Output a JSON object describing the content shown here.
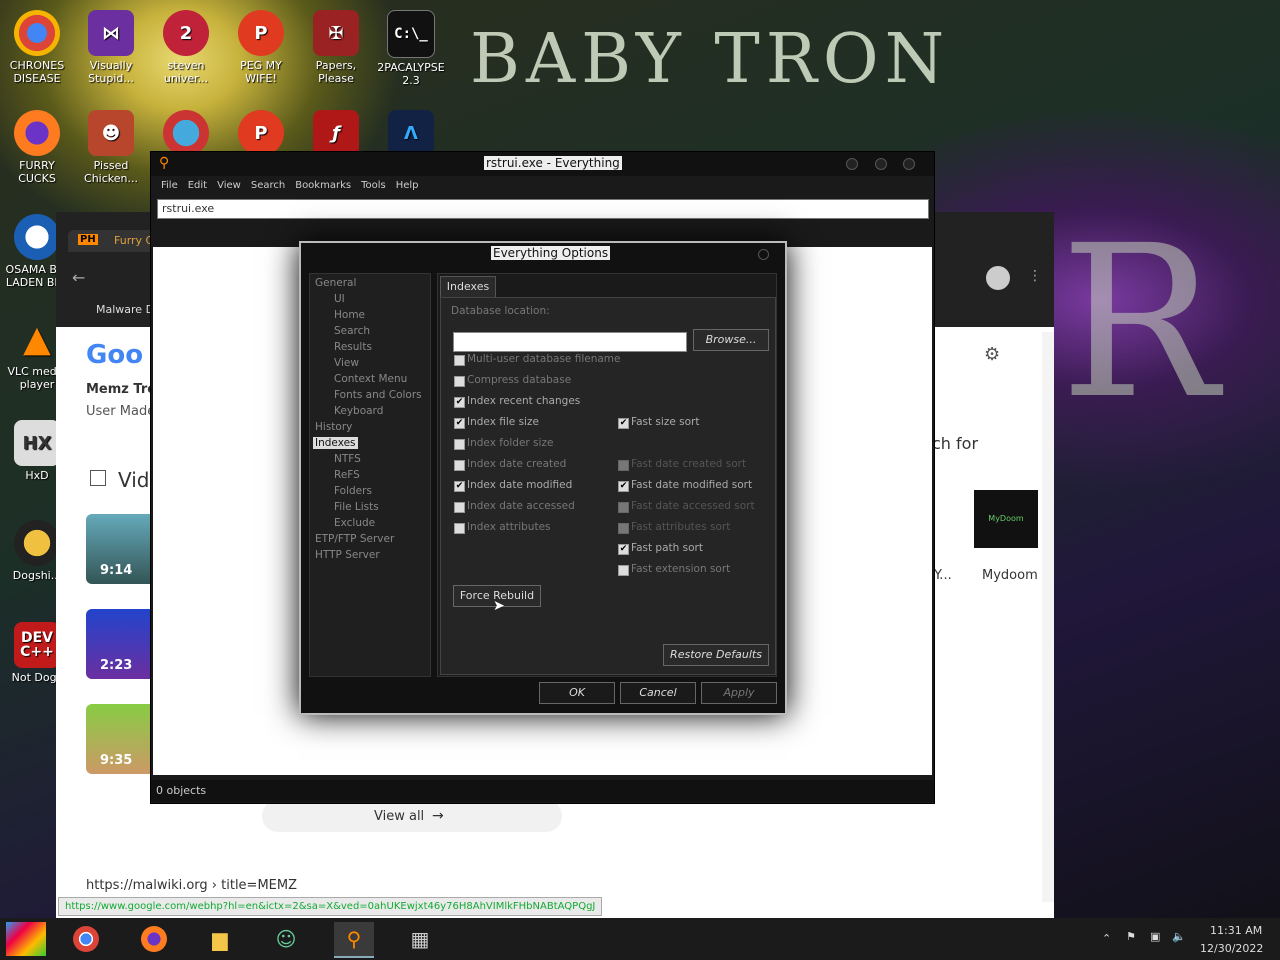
{
  "desktop": {
    "brand_text": "BABY TRON",
    "brand_text2": "R",
    "icons": [
      {
        "label": "CHRONES DISEASE",
        "icon": "chrome-icon"
      },
      {
        "label": "Visually Stupid...",
        "icon": "visual-studio-icon"
      },
      {
        "label": "steven univer...",
        "icon": "game-icon"
      },
      {
        "label": "PEG MY WIFE!",
        "icon": "game-icon"
      },
      {
        "label": "Papers, Please",
        "icon": "game-icon"
      },
      {
        "label": "2PACALYPSE 2.3",
        "icon": "terminal-icon"
      },
      {
        "label": "FURRY CUCKS",
        "icon": "firefox-icon"
      },
      {
        "label": "Pissed Chicken...",
        "icon": "game-icon"
      },
      {
        "label": "OSAMA BIN LADEN BI...",
        "icon": "obama-icon"
      },
      {
        "label": "VLC media player",
        "icon": "vlc-icon"
      },
      {
        "label": "HxD",
        "icon": "hxd-icon"
      },
      {
        "label": "Dogshi...",
        "icon": "app-icon"
      },
      {
        "label": "Not Dogs",
        "icon": "devcpp-icon"
      }
    ]
  },
  "chrome": {
    "tab_title": "Furry Ga...",
    "bookmark": "Malware D...",
    "result_title": "Memz Tro...",
    "result_sub": "User Made...",
    "videos_label": "Vid...",
    "durations": [
      "9:14",
      "2:23",
      "9:35"
    ],
    "search_for": "ch for",
    "mydoom_label": "Mydoom",
    "y_label": "Y...",
    "view_all": "View all",
    "url_line": "https://malwiki.org › title=MEMZ",
    "status_url": "https://www.google.com/webhp?hl=en&ictx=2&sa=X&ved=0ahUKEwjxt46y76H8AhVIMlkFHbNABtAQPQgJ"
  },
  "everything": {
    "title": "rstrui.exe - Everything",
    "menu": [
      "File",
      "Edit",
      "View",
      "Search",
      "Bookmarks",
      "Tools",
      "Help"
    ],
    "search_value": "rstrui.exe",
    "status": "0 objects"
  },
  "options": {
    "title": "Everything Options",
    "tree": [
      {
        "label": "General",
        "level": 0
      },
      {
        "label": "UI",
        "level": 1
      },
      {
        "label": "Home",
        "level": 1
      },
      {
        "label": "Search",
        "level": 1
      },
      {
        "label": "Results",
        "level": 1
      },
      {
        "label": "View",
        "level": 1
      },
      {
        "label": "Context Menu",
        "level": 1
      },
      {
        "label": "Fonts and Colors",
        "level": 1
      },
      {
        "label": "Keyboard",
        "level": 1
      },
      {
        "label": "History",
        "level": 0
      },
      {
        "label": "Indexes",
        "level": 0,
        "selected": true
      },
      {
        "label": "NTFS",
        "level": 1
      },
      {
        "label": "ReFS",
        "level": 1
      },
      {
        "label": "Folders",
        "level": 1
      },
      {
        "label": "File Lists",
        "level": 1
      },
      {
        "label": "Exclude",
        "level": 1
      },
      {
        "label": "ETP/FTP Server",
        "level": 0
      },
      {
        "label": "HTTP Server",
        "level": 0
      }
    ],
    "tab": "Indexes",
    "db_location_label": "Database location:",
    "db_location_value": "",
    "browse": "Browse...",
    "left_checks": [
      {
        "label": "Multi-user database filename",
        "checked": false
      },
      {
        "label": "Compress database",
        "checked": false
      },
      {
        "label": "Index recent changes",
        "checked": true
      },
      {
        "label": "Index file size",
        "checked": true
      },
      {
        "label": "Index folder size",
        "checked": false
      },
      {
        "label": "Index date created",
        "checked": false
      },
      {
        "label": "Index date modified",
        "checked": true
      },
      {
        "label": "Index date accessed",
        "checked": false
      },
      {
        "label": "Index attributes",
        "checked": false
      }
    ],
    "right_checks": [
      {
        "label": "Fast size sort",
        "checked": true,
        "enabled": true
      },
      {
        "label": "Fast date created sort",
        "checked": false,
        "enabled": false
      },
      {
        "label": "Fast date modified sort",
        "checked": true,
        "enabled": true
      },
      {
        "label": "Fast date accessed sort",
        "checked": false,
        "enabled": false
      },
      {
        "label": "Fast attributes sort",
        "checked": false,
        "enabled": false
      },
      {
        "label": "Fast path sort",
        "checked": true,
        "enabled": true
      },
      {
        "label": "Fast extension sort",
        "checked": false,
        "enabled": true
      }
    ],
    "force_rebuild": "Force Rebuild",
    "restore_defaults": "Restore Defaults",
    "ok": "OK",
    "cancel": "Cancel",
    "apply": "Apply"
  },
  "taskbar": {
    "time": "11:31 AM",
    "date": "12/30/2022",
    "apps": [
      "start-icon",
      "chrome-icon",
      "firefox-icon",
      "file-explorer-icon",
      "people-icon",
      "everything-icon",
      "calculator-icon"
    ]
  }
}
